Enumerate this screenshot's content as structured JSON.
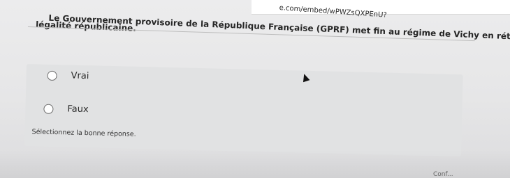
{
  "browser": {
    "url_fragment": "e.com/embed/wPWZsQXPEnU?"
  },
  "quiz": {
    "question": "Le Gouvernement provisoire de la République Française (GPRF) met fin au régime de Vichy en rétablissant la",
    "question_continuation": "légalité républicaine.",
    "options": [
      {
        "label": "Vrai",
        "selected": false
      },
      {
        "label": "Faux",
        "selected": false
      }
    ],
    "instruction": "Sélectionnez la bonne réponse."
  },
  "footer": {
    "partial_text": "Conf..."
  }
}
